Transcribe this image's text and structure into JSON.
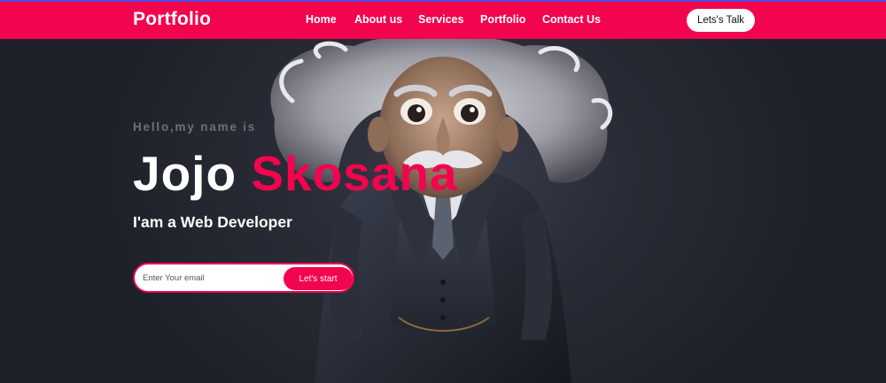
{
  "header": {
    "brand": "Portfolio",
    "nav": [
      "Home",
      "About us",
      "Services",
      "Portfolio",
      "Contact Us"
    ],
    "cta_label": "Lets's Talk"
  },
  "hero": {
    "greeting": "Hello,my name is",
    "first_name": "Jojo",
    "last_name": "Skosana",
    "role": "I'am a Web Developer",
    "email_placeholder": "Enter Your email",
    "submit_label": "Let's start",
    "portrait_icon": "einstein-caricature-illustration"
  },
  "colors": {
    "accent": "#f2044e",
    "background": "#1c1e27",
    "text_light": "#ffffff",
    "text_muted": "#6f6f78"
  }
}
